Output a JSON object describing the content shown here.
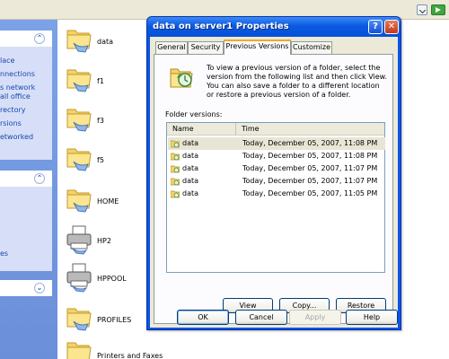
{
  "files": [
    {
      "name": "data",
      "type": "shared-folder"
    },
    {
      "name": "f1",
      "type": "shared-folder"
    },
    {
      "name": "f3",
      "type": "shared-folder"
    },
    {
      "name": "f5",
      "type": "shared-folder"
    },
    {
      "name": "HOME",
      "type": "shared-folder"
    },
    {
      "name": "HP2",
      "type": "printer"
    },
    {
      "name": "HPPOOL",
      "type": "printer"
    },
    {
      "name": "PROFILES",
      "type": "shared-folder"
    },
    {
      "name": "Printers and Faxes",
      "type": "folder"
    }
  ],
  "tasks": {
    "links_top": [
      "lace",
      "nnections",
      "s network",
      "all office",
      "rectory",
      "rsions",
      "etworked"
    ],
    "links_bottom": [
      "es"
    ],
    "collapse_up": "⌃",
    "collapse_down": "⌄"
  },
  "dialog": {
    "title": "data on server1 Properties",
    "help_glyph": "?",
    "close_glyph": "✕",
    "tabs": [
      {
        "label": "General",
        "active": false
      },
      {
        "label": "Security",
        "active": false
      },
      {
        "label": "Previous Versions",
        "active": true
      },
      {
        "label": "Customize",
        "active": false
      }
    ],
    "description": "To view a previous version of a folder, select the version from the following list and then click View.  You can also save a folder to a different location or restore a previous version of a folder.",
    "list_label": "Folder versions:",
    "columns": {
      "name": "Name",
      "time": "Time"
    },
    "versions": [
      {
        "name": "data",
        "time": "Today, December 05, 2007, 11:08 PM",
        "selected": true
      },
      {
        "name": "data",
        "time": "Today, December 05, 2007, 11:08 PM",
        "selected": false
      },
      {
        "name": "data",
        "time": "Today, December 05, 2007, 11:07 PM",
        "selected": false
      },
      {
        "name": "data",
        "time": "Today, December 05, 2007, 11:07 PM",
        "selected": false
      },
      {
        "name": "data",
        "time": "Today, December 05, 2007, 11:05 PM",
        "selected": false
      }
    ],
    "actions": {
      "view": "View",
      "copy": "Copy...",
      "restore": "Restore"
    },
    "footer": {
      "ok": "OK",
      "cancel": "Cancel",
      "apply": "Apply",
      "help": "Help"
    }
  },
  "colors": {
    "titlebar": "#0550d8",
    "task_pane": "#6b8fd9",
    "dialog_face": "#ece9d8",
    "tab_highlight": "#f5a623"
  }
}
